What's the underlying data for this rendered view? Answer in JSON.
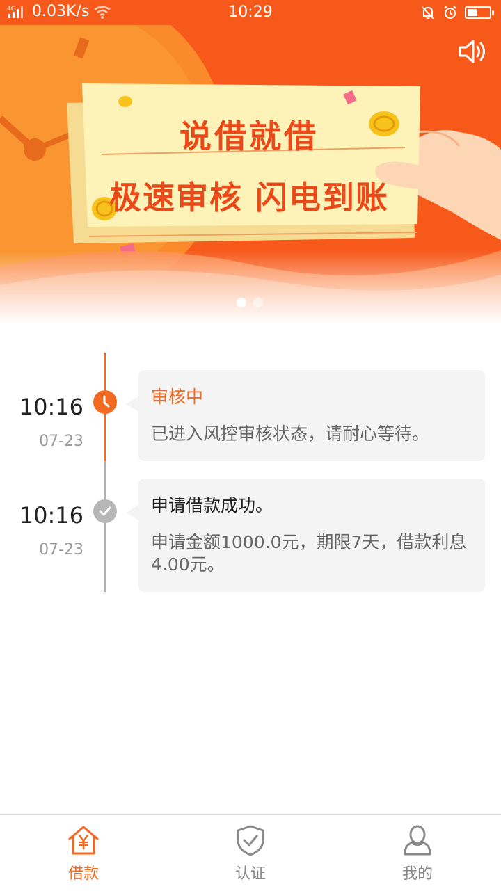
{
  "status_bar": {
    "network_type": "4G",
    "speed": "0.03K/s",
    "time": "10:29",
    "battery_level": 0.45
  },
  "banner": {
    "title_line1": "说借就借",
    "title_line2": "极速审核 闪电到账",
    "slide_count": 2,
    "active_slide": 0,
    "colors": {
      "background": "#f7591a",
      "title": "#ea4a1a",
      "paper": "#fdf2b8"
    }
  },
  "timeline": {
    "items": [
      {
        "time": "10:16",
        "date": "07-23",
        "title": "审核中",
        "description": "已进入风控审核状态，请耐心等待。",
        "status_icon": "clock-icon",
        "status_color": "#f26a22"
      },
      {
        "time": "10:16",
        "date": "07-23",
        "title": "申请借款成功。",
        "description": "申请金额1000.0元，期限7天，借款利息4.00元。",
        "status_icon": "check-icon",
        "status_color": "#b7b7b7"
      }
    ]
  },
  "tabbar": {
    "tabs": [
      {
        "label": "借款",
        "icon": "home-yuan-icon",
        "active": true
      },
      {
        "label": "认证",
        "icon": "shield-check-icon",
        "active": false
      },
      {
        "label": "我的",
        "icon": "user-icon",
        "active": false
      }
    ],
    "active_color": "#f26a22"
  }
}
